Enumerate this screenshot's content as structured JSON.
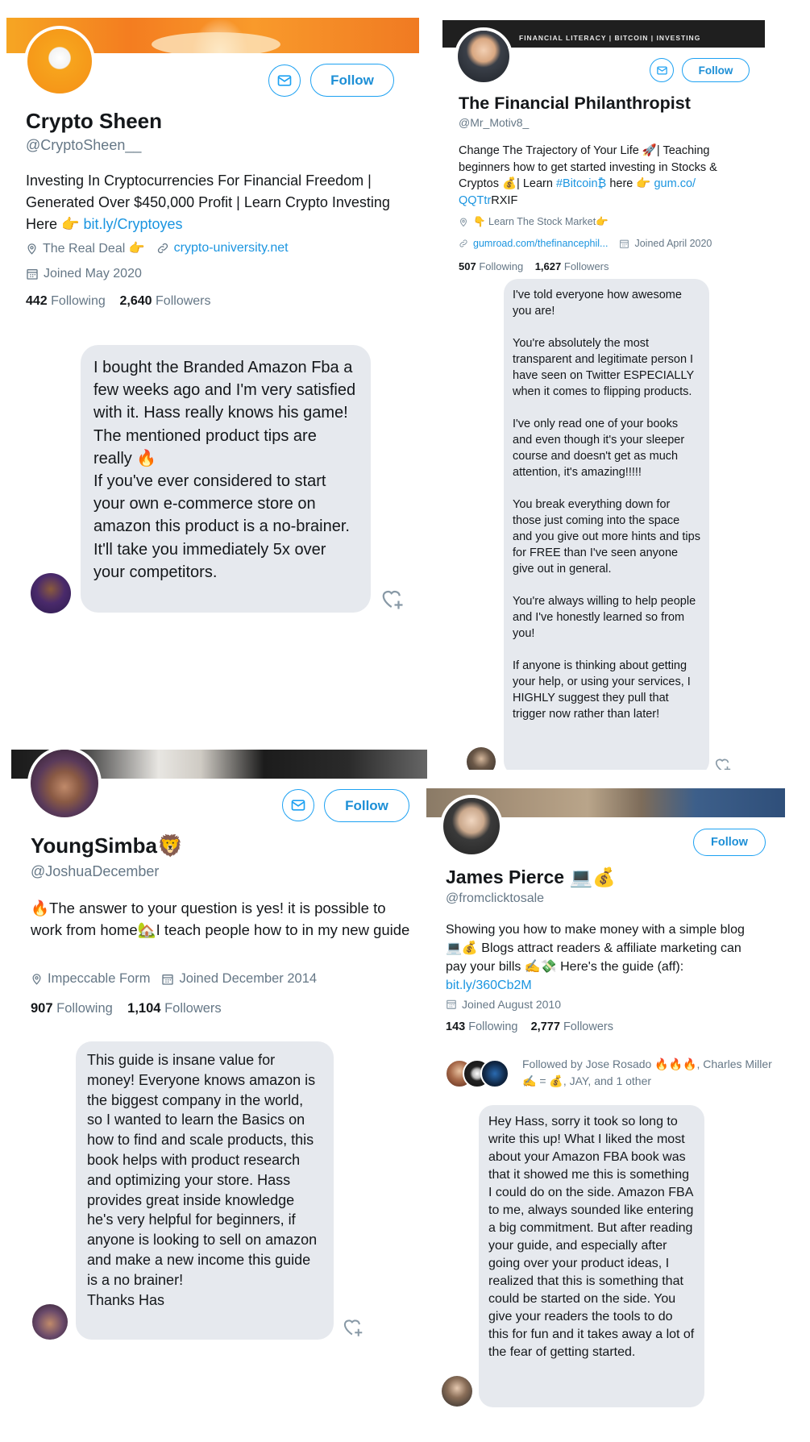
{
  "panel1": {
    "name": "Crypto Sheen",
    "handle": "@CryptoSheen__",
    "bio_text": "Investing In Cryptocurrencies For Financial Freedom | Generated Over $450,000 Profit | Learn Crypto Investing Here 👉",
    "bio_link": "bit.ly/Cryptoyes",
    "location": "The Real Deal 👉",
    "website": "crypto-university.net",
    "joined": "Joined May 2020",
    "following_count": "442",
    "following_label": "Following",
    "followers_count": "2,640",
    "followers_label": "Followers",
    "follow_label": "Follow",
    "icons": [
      "mail-icon",
      "location-icon",
      "link-icon",
      "calendar-icon",
      "heart-plus-icon"
    ],
    "dm_text": "I bought the Branded Amazon Fba a few weeks ago and I'm very satisfied with it. Hass really knows his game! The mentioned product tips are really 🔥\nIf you've ever considered to start your own e-commerce store on amazon this product is a no-brainer. It'll take you immediately 5x over your competitors."
  },
  "panel2": {
    "banner_text": "FINANCIAL LITERACY | BITCOIN | INVESTING",
    "name": "The Financial Philanthropist",
    "handle": "@Mr_Motiv8_",
    "bio_text_1": "Change The Trajectory of Your Life 🚀| Teaching beginners how to get started investing in Stocks & Cryptos 💰| Learn",
    "bio_hashtag": "#Bitcoin₿",
    "bio_text_2": "here 👉",
    "bio_link_1": "gum.co/",
    "bio_link_2": "QQTtr",
    "bio_text_3": "RXIF",
    "location": "👇 Learn The Stock Market👉",
    "website": "gumroad.com/thefinancephil...",
    "joined": "Joined April 2020",
    "following_count": "507",
    "following_label": "Following",
    "followers_count": "1,627",
    "followers_label": "Followers",
    "follow_label": "Follow",
    "dm_text": "I've told everyone how awesome you are!\n\nYou're absolutely the most transparent and legitimate person I have seen on Twitter ESPECIALLY when it comes to flipping products.\n\nI've only read one of your books and even though it's your sleeper course and doesn't get as much attention, it's amazing!!!!!\n\nYou break everything down for those just coming into the space and you give out more hints and tips for FREE than I've seen anyone give out in general.\n\nYou're always willing to help people and I've honestly learned so from you!\n\nIf anyone is thinking about getting your help, or using your services, I HIGHLY suggest they pull that trigger now rather than later!"
  },
  "panel3": {
    "name": "YoungSimba🦁",
    "handle": "@JoshuaDecember",
    "bio_text": "🔥The answer to your question is yes! it is possible to work from home🏡I teach people how to in my new guide",
    "location": "Impeccable Form",
    "joined": "Joined December 2014",
    "following_count": "907",
    "following_label": "Following",
    "followers_count": "1,104",
    "followers_label": "Followers",
    "follow_label": "Follow",
    "dm_text": "This guide is insane value for money! Everyone knows amazon is the biggest company in the world, so I wanted to learn the Basics on how to find and scale products, this book helps with product research and optimizing your store. Hass provides great inside knowledge he's very helpful for beginners, if anyone is looking to sell on amazon and make a new income this guide is a no brainer!\nThanks Has"
  },
  "panel4": {
    "name": "James Pierce 💻💰",
    "handle": "@fromclicktosale",
    "bio_text": "Showing you how to make money with a simple blog 💻💰 Blogs attract readers & affiliate marketing can pay your bills ✍️💸 Here's the guide (aff):",
    "bio_link": "bit.ly/360Cb2M",
    "joined": "Joined August 2010",
    "following_count": "143",
    "following_label": "Following",
    "followers_count": "2,777",
    "followers_label": "Followers",
    "follow_label": "Follow",
    "followed_by": "Followed by Jose Rosado 🔥🔥🔥, Charles Miller ✍️ = 💰, JAY, and 1 other",
    "dm_text": "Hey Hass, sorry it took so long to write this up! What I liked the most about your Amazon FBA book was that it showed me this is something I could do on the side. Amazon FBA to me, always sounded like entering a big commitment. But after reading your guide, and especially after going over your product ideas, I realized that this is something that could be started on the side. You give your readers the tools to do this for fun and it takes away a lot of the fear of getting started."
  },
  "colors": {
    "accent": "#1da1f2",
    "link": "#1b95e0",
    "muted": "#657786",
    "bubble": "#e6e9ee",
    "banner1": "#f7941d"
  }
}
